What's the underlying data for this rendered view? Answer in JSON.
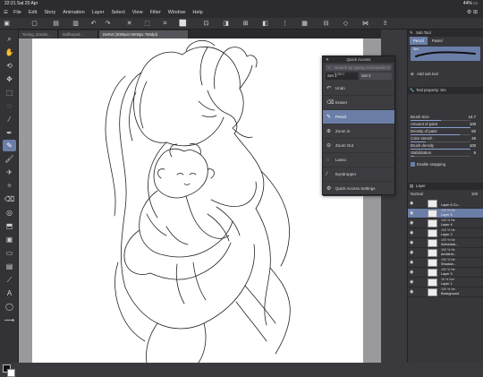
{
  "status": {
    "time": "22:21",
    "date": "Sat 20 Apr",
    "battery": "44%"
  },
  "menu": {
    "items": [
      "File",
      "Edit",
      "Story",
      "Animation",
      "Layer",
      "Select",
      "View",
      "Filter",
      "Window",
      "Help"
    ]
  },
  "tabs": [
    {
      "label": "Toning_Garam..."
    },
    {
      "label": "Dollhoped..."
    },
    {
      "label": "DeRet (3000px×3000px 750dpi)"
    }
  ],
  "quick_access": {
    "title": "Quick Access",
    "search_placeholder": "Search by typing commands or folder",
    "sets": [
      "Set 1",
      "Set 2"
    ],
    "items": [
      "Undo",
      "Eraser",
      "Pencil",
      "Zoom in",
      "Zoom Out",
      "Lasso",
      "Eyedropper",
      "Quick Access Settings"
    ],
    "active_item": "Pencil"
  },
  "sub_tool": {
    "header": "Sub Tool",
    "tabs": [
      "Pencil",
      "Pastel"
    ],
    "brush_name": "Sm",
    "add_label": "Add sub tool"
  },
  "tool_property": {
    "header": "Tool property: Sm",
    "props": [
      {
        "label": "Brush Size",
        "value": "14.7",
        "fill": 0.5
      },
      {
        "label": "Amount of paint",
        "value": "100",
        "fill": 1.0
      },
      {
        "label": "Density of paint",
        "value": "82",
        "fill": 0.82
      },
      {
        "label": "Color stretch",
        "value": "25",
        "fill": 0.25
      },
      {
        "label": "Brush density",
        "value": "100",
        "fill": 1.0
      },
      {
        "label": "Stabilization",
        "value": "6",
        "fill": 0.06
      }
    ],
    "enable_snapping": "Enable snapping"
  },
  "layer_panel": {
    "header": "Layer",
    "blend_mode": "Normal",
    "opacity": "100",
    "layers": [
      {
        "opacity": "",
        "name": "Layer 6 Co...",
        "active": false
      },
      {
        "opacity": "100 % Ne",
        "name": "Layer 5",
        "active": true
      },
      {
        "opacity": "100 % Ne",
        "name": "Layer 4",
        "active": false
      },
      {
        "opacity": "100 % Ne",
        "name": "Layer 2",
        "active": false
      },
      {
        "opacity": "100 % Ne",
        "name": "Adminsta...",
        "active": false
      },
      {
        "opacity": "100 % Ne",
        "name": "Ambient...",
        "active": false
      },
      {
        "opacity": "100 % Ne",
        "name": "Shadow...",
        "active": false
      },
      {
        "opacity": "100 % Ne",
        "name": "Layer 3",
        "active": false
      },
      {
        "opacity": "15 % Nor",
        "name": "Layer 1",
        "active": false
      },
      {
        "opacity": "100 % Ne",
        "name": "Background",
        "active": false
      }
    ]
  }
}
